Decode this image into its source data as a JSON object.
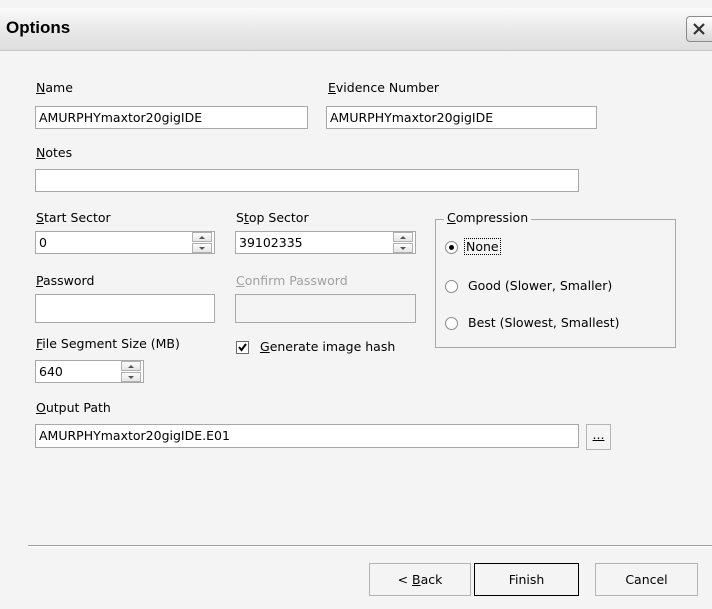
{
  "window": {
    "title": "Options"
  },
  "name": {
    "label_key": "N",
    "label_rest": "ame",
    "value": "AMURPHYmaxtor20gigIDE"
  },
  "evidence_number": {
    "label_key": "E",
    "label_rest": "vidence Number",
    "value": "AMURPHYmaxtor20gigIDE"
  },
  "notes": {
    "label_key": "N",
    "label_rest": "otes",
    "value": ""
  },
  "start_sector": {
    "label_key": "S",
    "label_rest": "tart Sector",
    "value": "0"
  },
  "stop_sector": {
    "label_pre": "S",
    "label_key": "t",
    "label_rest": "op Sector",
    "value": "39102335"
  },
  "password": {
    "label_key": "P",
    "label_rest": "assword",
    "value": ""
  },
  "confirm_password": {
    "label_key": "C",
    "label_rest": "onfirm Password",
    "value": ""
  },
  "file_segment_size": {
    "label_key": "F",
    "label_rest": "ile Segment Size (MB)",
    "value": "640"
  },
  "generate_hash": {
    "label_key": "G",
    "label_rest": "enerate image hash",
    "checked": true
  },
  "compression": {
    "label_key": "C",
    "label_rest": "ompression",
    "options": [
      {
        "label": "None",
        "selected": true
      },
      {
        "label": "Good (Slower, Smaller)",
        "selected": false
      },
      {
        "label": "Best (Slowest, Smallest)",
        "selected": false
      }
    ]
  },
  "output_path": {
    "label_key": "O",
    "label_rest": "utput Path",
    "value": "AMURPHYmaxtor20gigIDE.E01",
    "browse_label": "..."
  },
  "buttons": {
    "back_pre": "< ",
    "back_key": "B",
    "back_rest": "ack",
    "finish": "Finish",
    "cancel": "Cancel"
  }
}
